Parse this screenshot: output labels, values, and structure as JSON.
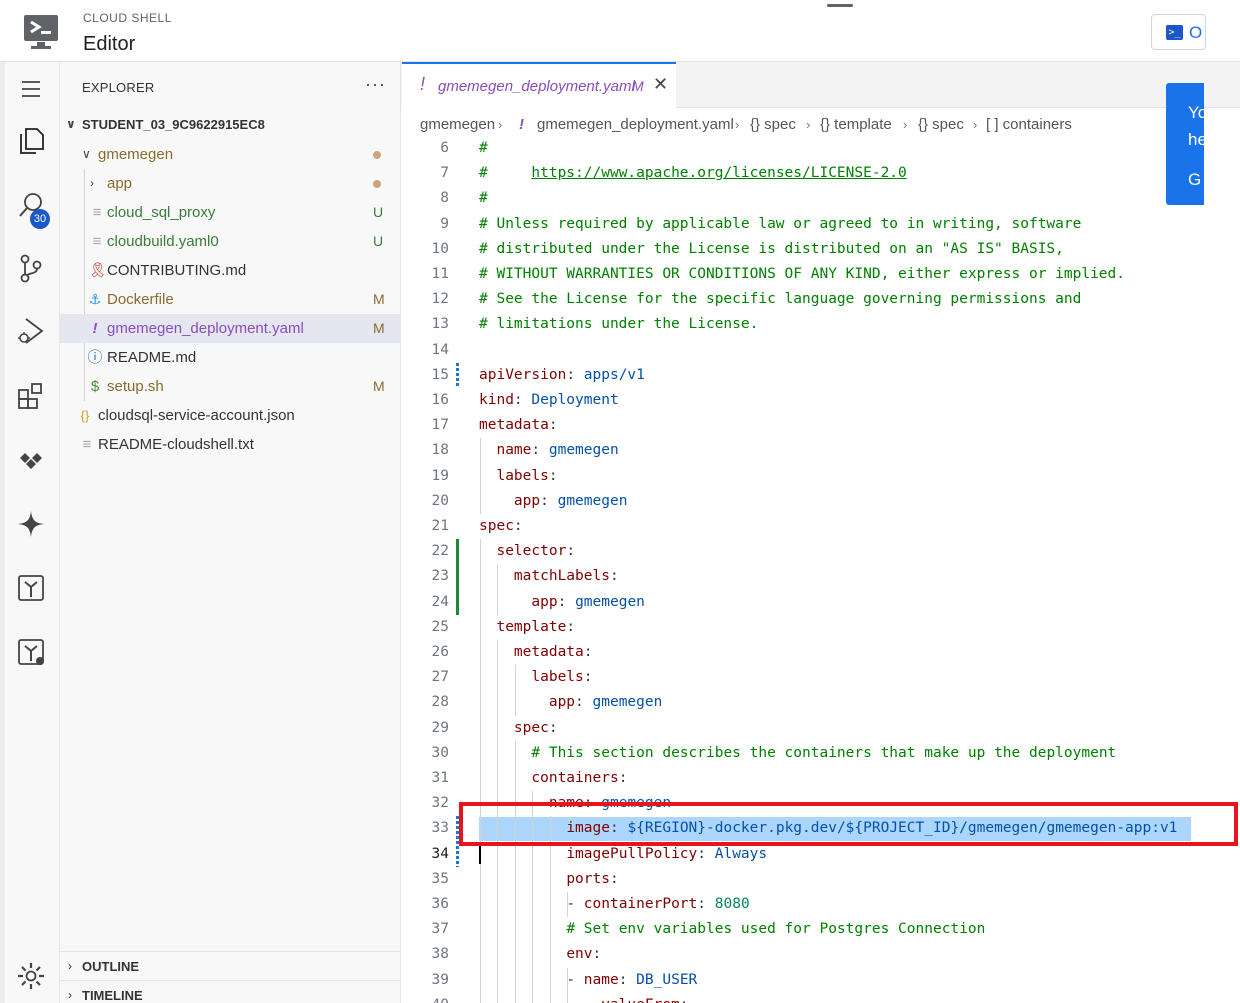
{
  "header": {
    "product": "CLOUD SHELL",
    "title": "Editor",
    "open_button_label": "O",
    "open_button_icon": "terminal-icon"
  },
  "activity_bar": {
    "items": [
      {
        "name": "menu-icon"
      },
      {
        "name": "explorer-icon"
      },
      {
        "name": "search-icon"
      },
      {
        "name": "source-control-icon",
        "badge": "30"
      },
      {
        "name": "run-debug-icon"
      },
      {
        "name": "extensions-icon"
      },
      {
        "name": "cloud-code-icon"
      },
      {
        "name": "gemini-icon"
      },
      {
        "name": "terraform-icon"
      },
      {
        "name": "terraform-cloud-icon"
      },
      {
        "name": "settings-gear-icon"
      }
    ]
  },
  "explorer": {
    "title": "EXPLORER",
    "more": "···",
    "root": "STUDENT_03_9C9622915EC8",
    "items": [
      {
        "label": "gmemegen",
        "type": "folder-open",
        "status": "dot"
      },
      {
        "label": "app",
        "type": "folder",
        "status": "dot"
      },
      {
        "label": "cloud_sql_proxy",
        "type": "file",
        "status": "U"
      },
      {
        "label": "cloudbuild.yaml0",
        "type": "file",
        "status": "U"
      },
      {
        "label": "CONTRIBUTING.md",
        "type": "ribbon",
        "status": ""
      },
      {
        "label": "Dockerfile",
        "type": "docker",
        "status": "M"
      },
      {
        "label": "gmemegen_deployment.yaml",
        "type": "yaml",
        "status": "M"
      },
      {
        "label": "README.md",
        "type": "info",
        "status": ""
      },
      {
        "label": "setup.sh",
        "type": "shell",
        "status": "M"
      },
      {
        "label": "cloudsql-service-account.json",
        "type": "json",
        "status": ""
      },
      {
        "label": "README-cloudshell.txt",
        "type": "file",
        "status": ""
      }
    ],
    "sections": [
      "OUTLINE",
      "TIMELINE"
    ]
  },
  "editor": {
    "tab": {
      "label": "gmemegen_deployment.yaml",
      "status": "M",
      "close": "✕"
    },
    "breadcrumb": [
      "gmemegen",
      "gmemegen_deployment.yaml",
      "{} spec",
      "{} template",
      "{} spec",
      "[ ] containers"
    ],
    "lines": [
      {
        "n": "6",
        "text": "#"
      },
      {
        "n": "7",
        "text": "#     ",
        "link": "https://www.apache.org/licenses/LICENSE-2.0"
      },
      {
        "n": "8",
        "text": "#"
      },
      {
        "n": "9",
        "text": "# Unless required by applicable law or agreed to in writing, software"
      },
      {
        "n": "10",
        "text": "# distributed under the License is distributed on an \"AS IS\" BASIS,"
      },
      {
        "n": "11",
        "text": "# WITHOUT WARRANTIES OR CONDITIONS OF ANY KIND, either express or implied."
      },
      {
        "n": "12",
        "text": "# See the License for the specific language governing permissions and"
      },
      {
        "n": "13",
        "text": "# limitations under the License."
      },
      {
        "n": "14",
        "text": ""
      },
      {
        "n": "15",
        "key": "apiVersion",
        "val": "apps/v1",
        "indent": 0
      },
      {
        "n": "16",
        "key": "kind",
        "val": "Deployment",
        "indent": 0
      },
      {
        "n": "17",
        "key": "metadata",
        "val": "",
        "indent": 0
      },
      {
        "n": "18",
        "key": "name",
        "val": "gmemegen",
        "indent": 1
      },
      {
        "n": "19",
        "key": "labels",
        "val": "",
        "indent": 1
      },
      {
        "n": "20",
        "key": "app",
        "val": "gmemegen",
        "indent": 2
      },
      {
        "n": "21",
        "key": "spec",
        "val": "",
        "indent": 0
      },
      {
        "n": "22",
        "key": "selector",
        "val": "",
        "indent": 1
      },
      {
        "n": "23",
        "key": "matchLabels",
        "val": "",
        "indent": 2
      },
      {
        "n": "24",
        "key": "app",
        "val": "gmemegen",
        "indent": 3
      },
      {
        "n": "25",
        "key": "template",
        "val": "",
        "indent": 1
      },
      {
        "n": "26",
        "key": "metadata",
        "val": "",
        "indent": 2
      },
      {
        "n": "27",
        "key": "labels",
        "val": "",
        "indent": 3
      },
      {
        "n": "28",
        "key": "app",
        "val": "gmemegen",
        "indent": 4
      },
      {
        "n": "29",
        "key": "spec",
        "val": "",
        "indent": 2
      },
      {
        "n": "30",
        "comment": "# This section describes the containers that make up the deployment",
        "indent": 3
      },
      {
        "n": "31",
        "key": "containers",
        "val": "",
        "indent": 3
      },
      {
        "n": "32",
        "dash": true,
        "key": "name",
        "val": "gmemegen",
        "indent": 4
      },
      {
        "n": "33",
        "key": "image",
        "val": "${REGION}-docker.pkg.dev/${PROJECT_ID}/gmemegen/gmemegen-app:v1",
        "indent": 5
      },
      {
        "n": "34",
        "key": "imagePullPolicy",
        "val": "Always",
        "indent": 5
      },
      {
        "n": "35",
        "key": "ports",
        "val": "",
        "indent": 5
      },
      {
        "n": "36",
        "dash": true,
        "key": "containerPort",
        "num": "8080",
        "indent": 6
      },
      {
        "n": "37",
        "comment": "# Set env variables used for Postgres Connection",
        "indent": 5
      },
      {
        "n": "38",
        "key": "env",
        "val": "",
        "indent": 5
      },
      {
        "n": "39",
        "dash": true,
        "key": "name",
        "val": "DB_USER",
        "indent": 6
      },
      {
        "n": "40",
        "key": "valueFrom",
        "val": "",
        "indent": 7
      }
    ]
  },
  "notification": {
    "lines": [
      "Yo",
      "he",
      "G"
    ]
  },
  "colors": {
    "accent": "#1a73e8",
    "highlight_box": "#e8141c",
    "selection": "#add6ff"
  }
}
